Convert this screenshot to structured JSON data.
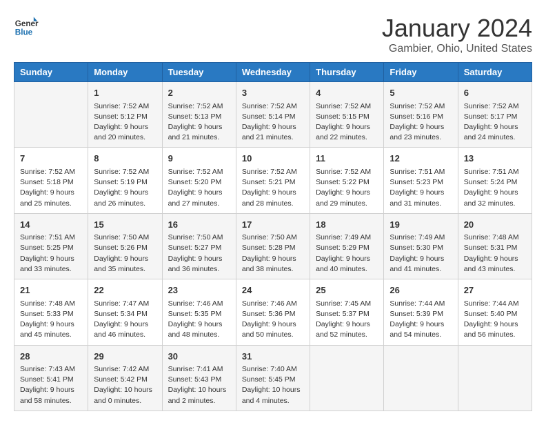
{
  "logo": {
    "text_general": "General",
    "text_blue": "Blue"
  },
  "title": "January 2024",
  "subtitle": "Gambier, Ohio, United States",
  "days_of_week": [
    "Sunday",
    "Monday",
    "Tuesday",
    "Wednesday",
    "Thursday",
    "Friday",
    "Saturday"
  ],
  "weeks": [
    [
      {
        "day": "",
        "info": ""
      },
      {
        "day": "1",
        "info": "Sunrise: 7:52 AM\nSunset: 5:12 PM\nDaylight: 9 hours\nand 20 minutes."
      },
      {
        "day": "2",
        "info": "Sunrise: 7:52 AM\nSunset: 5:13 PM\nDaylight: 9 hours\nand 21 minutes."
      },
      {
        "day": "3",
        "info": "Sunrise: 7:52 AM\nSunset: 5:14 PM\nDaylight: 9 hours\nand 21 minutes."
      },
      {
        "day": "4",
        "info": "Sunrise: 7:52 AM\nSunset: 5:15 PM\nDaylight: 9 hours\nand 22 minutes."
      },
      {
        "day": "5",
        "info": "Sunrise: 7:52 AM\nSunset: 5:16 PM\nDaylight: 9 hours\nand 23 minutes."
      },
      {
        "day": "6",
        "info": "Sunrise: 7:52 AM\nSunset: 5:17 PM\nDaylight: 9 hours\nand 24 minutes."
      }
    ],
    [
      {
        "day": "7",
        "info": "Sunrise: 7:52 AM\nSunset: 5:18 PM\nDaylight: 9 hours\nand 25 minutes."
      },
      {
        "day": "8",
        "info": "Sunrise: 7:52 AM\nSunset: 5:19 PM\nDaylight: 9 hours\nand 26 minutes."
      },
      {
        "day": "9",
        "info": "Sunrise: 7:52 AM\nSunset: 5:20 PM\nDaylight: 9 hours\nand 27 minutes."
      },
      {
        "day": "10",
        "info": "Sunrise: 7:52 AM\nSunset: 5:21 PM\nDaylight: 9 hours\nand 28 minutes."
      },
      {
        "day": "11",
        "info": "Sunrise: 7:52 AM\nSunset: 5:22 PM\nDaylight: 9 hours\nand 29 minutes."
      },
      {
        "day": "12",
        "info": "Sunrise: 7:51 AM\nSunset: 5:23 PM\nDaylight: 9 hours\nand 31 minutes."
      },
      {
        "day": "13",
        "info": "Sunrise: 7:51 AM\nSunset: 5:24 PM\nDaylight: 9 hours\nand 32 minutes."
      }
    ],
    [
      {
        "day": "14",
        "info": "Sunrise: 7:51 AM\nSunset: 5:25 PM\nDaylight: 9 hours\nand 33 minutes."
      },
      {
        "day": "15",
        "info": "Sunrise: 7:50 AM\nSunset: 5:26 PM\nDaylight: 9 hours\nand 35 minutes."
      },
      {
        "day": "16",
        "info": "Sunrise: 7:50 AM\nSunset: 5:27 PM\nDaylight: 9 hours\nand 36 minutes."
      },
      {
        "day": "17",
        "info": "Sunrise: 7:50 AM\nSunset: 5:28 PM\nDaylight: 9 hours\nand 38 minutes."
      },
      {
        "day": "18",
        "info": "Sunrise: 7:49 AM\nSunset: 5:29 PM\nDaylight: 9 hours\nand 40 minutes."
      },
      {
        "day": "19",
        "info": "Sunrise: 7:49 AM\nSunset: 5:30 PM\nDaylight: 9 hours\nand 41 minutes."
      },
      {
        "day": "20",
        "info": "Sunrise: 7:48 AM\nSunset: 5:31 PM\nDaylight: 9 hours\nand 43 minutes."
      }
    ],
    [
      {
        "day": "21",
        "info": "Sunrise: 7:48 AM\nSunset: 5:33 PM\nDaylight: 9 hours\nand 45 minutes."
      },
      {
        "day": "22",
        "info": "Sunrise: 7:47 AM\nSunset: 5:34 PM\nDaylight: 9 hours\nand 46 minutes."
      },
      {
        "day": "23",
        "info": "Sunrise: 7:46 AM\nSunset: 5:35 PM\nDaylight: 9 hours\nand 48 minutes."
      },
      {
        "day": "24",
        "info": "Sunrise: 7:46 AM\nSunset: 5:36 PM\nDaylight: 9 hours\nand 50 minutes."
      },
      {
        "day": "25",
        "info": "Sunrise: 7:45 AM\nSunset: 5:37 PM\nDaylight: 9 hours\nand 52 minutes."
      },
      {
        "day": "26",
        "info": "Sunrise: 7:44 AM\nSunset: 5:39 PM\nDaylight: 9 hours\nand 54 minutes."
      },
      {
        "day": "27",
        "info": "Sunrise: 7:44 AM\nSunset: 5:40 PM\nDaylight: 9 hours\nand 56 minutes."
      }
    ],
    [
      {
        "day": "28",
        "info": "Sunrise: 7:43 AM\nSunset: 5:41 PM\nDaylight: 9 hours\nand 58 minutes."
      },
      {
        "day": "29",
        "info": "Sunrise: 7:42 AM\nSunset: 5:42 PM\nDaylight: 10 hours\nand 0 minutes."
      },
      {
        "day": "30",
        "info": "Sunrise: 7:41 AM\nSunset: 5:43 PM\nDaylight: 10 hours\nand 2 minutes."
      },
      {
        "day": "31",
        "info": "Sunrise: 7:40 AM\nSunset: 5:45 PM\nDaylight: 10 hours\nand 4 minutes."
      },
      {
        "day": "",
        "info": ""
      },
      {
        "day": "",
        "info": ""
      },
      {
        "day": "",
        "info": ""
      }
    ]
  ]
}
